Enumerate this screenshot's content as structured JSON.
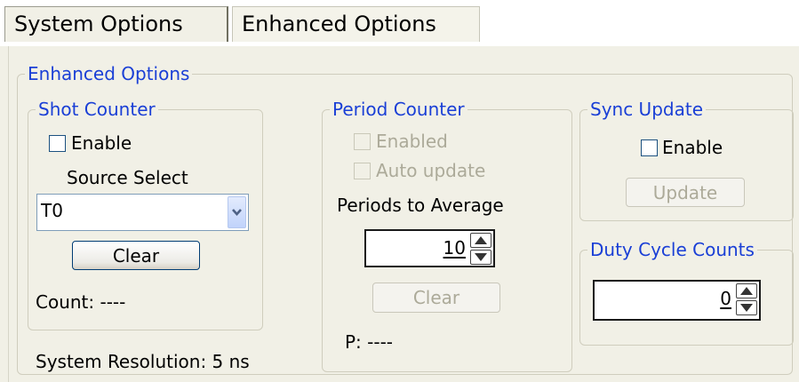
{
  "tabs": [
    {
      "label": "System Options",
      "active": false
    },
    {
      "label": "Enhanced Options",
      "active": true
    }
  ],
  "enhanced_options": {
    "legend": "Enhanced Options",
    "shot_counter": {
      "legend": "Shot Counter",
      "enable_label": "Enable",
      "enable_checked": false,
      "source_select_label": "Source Select",
      "source_value": "T0",
      "clear_label": "Clear",
      "count_text": "Count: ----"
    },
    "period_counter": {
      "legend": "Period Counter",
      "enabled_label": "Enabled",
      "auto_update_label": "Auto update",
      "periods_label": "Periods to Average",
      "periods_value": "10",
      "clear_label": "Clear",
      "p_text": "P: ----"
    },
    "sync_update": {
      "legend": "Sync Update",
      "enable_label": "Enable",
      "enable_checked": false,
      "update_label": "Update"
    },
    "duty_cycle": {
      "legend": "Duty Cycle Counts",
      "value": "0"
    },
    "system_resolution": "System Resolution: 5 ns"
  },
  "colors": {
    "legend": "#1a3fd6",
    "panel_bg": "#f1f0e6",
    "disabled_text": "#acaa99",
    "button_border": "#003c74"
  },
  "icons": {
    "dropdown": "chevron-down-icon",
    "spin_up": "arrow-up-icon",
    "spin_down": "arrow-down-icon"
  }
}
